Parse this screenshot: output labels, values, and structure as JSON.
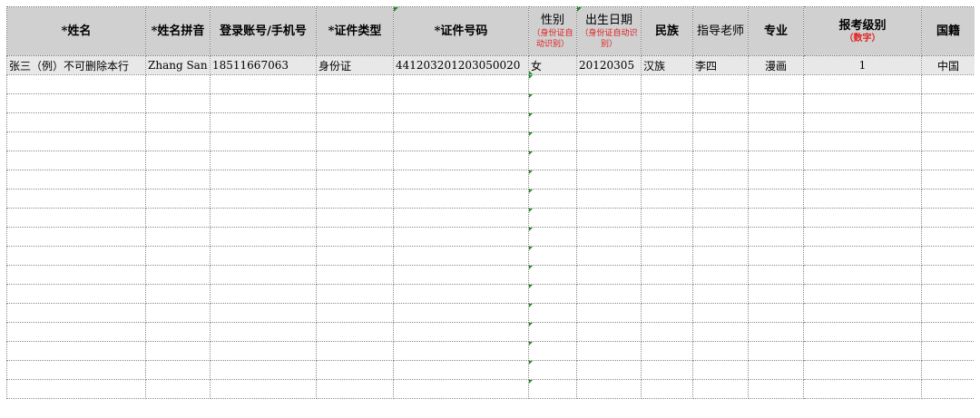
{
  "headers": [
    {
      "label": "*姓名",
      "sub": "",
      "plain": false
    },
    {
      "label": "*姓名拼音",
      "sub": "",
      "plain": false
    },
    {
      "label": "登录账号/手机号",
      "sub": "",
      "plain": false
    },
    {
      "label": "*证件类型",
      "sub": "",
      "plain": false
    },
    {
      "label": "*证件号码",
      "sub": "",
      "plain": false
    },
    {
      "label": "性别",
      "sub": "（身份证自动识别）",
      "plain": true
    },
    {
      "label": "出生日期",
      "sub": "（身份证自动识别）",
      "plain": true
    },
    {
      "label": "民族",
      "sub": "",
      "plain": false
    },
    {
      "label": "指导老师",
      "sub": "",
      "plain": true
    },
    {
      "label": "专业",
      "sub": "",
      "plain": false
    },
    {
      "label": "报考级别",
      "sub": "（数字）",
      "plain": false
    },
    {
      "label": "国籍",
      "sub": "",
      "plain": false
    }
  ],
  "example_row": [
    "张三（例）不可删除本行",
    "Zhang San",
    "18511667063",
    "身份证",
    "441203201203050020",
    "女",
    "20120305",
    "汉族",
    "李四",
    "漫画",
    "1",
    "中国"
  ],
  "empty_row_count": 17,
  "colors": {
    "header_bg": "#d0d0d0",
    "note_red": "#e02020",
    "indicator_green": "#1e8a1e"
  }
}
